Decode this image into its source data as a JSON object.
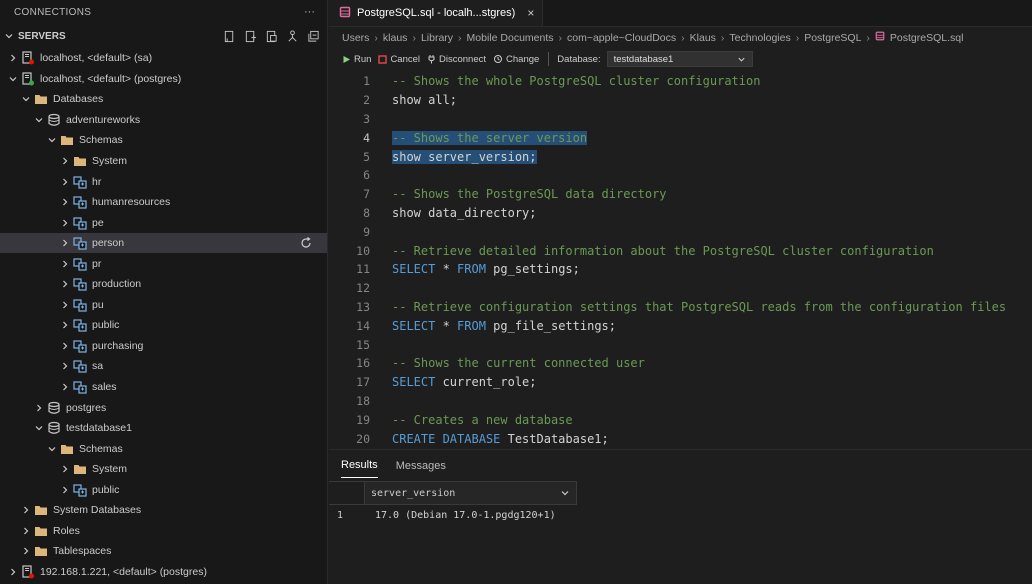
{
  "sidebar": {
    "title": "CONNECTIONS",
    "more": "···",
    "servers_label": "SERVERS",
    "tree": [
      {
        "label": "localhost, <default> (sa)",
        "depth": 1,
        "chev": "right",
        "icon": "server-error"
      },
      {
        "label": "localhost, <default> (postgres)",
        "depth": 1,
        "chev": "down",
        "icon": "server-connected"
      },
      {
        "label": "Databases",
        "depth": 2,
        "chev": "down",
        "icon": "folder"
      },
      {
        "label": "adventureworks",
        "depth": 3,
        "chev": "down",
        "icon": "database"
      },
      {
        "label": "Schemas",
        "depth": 4,
        "chev": "down",
        "icon": "folder"
      },
      {
        "label": "System",
        "depth": 5,
        "chev": "right",
        "icon": "folder"
      },
      {
        "label": "hr",
        "depth": 5,
        "chev": "right",
        "icon": "schema"
      },
      {
        "label": "humanresources",
        "depth": 5,
        "chev": "right",
        "icon": "schema"
      },
      {
        "label": "pe",
        "depth": 5,
        "chev": "right",
        "icon": "schema"
      },
      {
        "label": "person",
        "depth": 5,
        "chev": "right",
        "icon": "schema",
        "selected": true
      },
      {
        "label": "pr",
        "depth": 5,
        "chev": "right",
        "icon": "schema"
      },
      {
        "label": "production",
        "depth": 5,
        "chev": "right",
        "icon": "schema"
      },
      {
        "label": "pu",
        "depth": 5,
        "chev": "right",
        "icon": "schema"
      },
      {
        "label": "public",
        "depth": 5,
        "chev": "right",
        "icon": "schema"
      },
      {
        "label": "purchasing",
        "depth": 5,
        "chev": "right",
        "icon": "schema"
      },
      {
        "label": "sa",
        "depth": 5,
        "chev": "right",
        "icon": "schema"
      },
      {
        "label": "sales",
        "depth": 5,
        "chev": "right",
        "icon": "schema"
      },
      {
        "label": "postgres",
        "depth": 3,
        "chev": "right",
        "icon": "database"
      },
      {
        "label": "testdatabase1",
        "depth": 3,
        "chev": "down",
        "icon": "database"
      },
      {
        "label": "Schemas",
        "depth": 4,
        "chev": "down",
        "icon": "folder"
      },
      {
        "label": "System",
        "depth": 5,
        "chev": "right",
        "icon": "folder"
      },
      {
        "label": "public",
        "depth": 5,
        "chev": "right",
        "icon": "schema"
      },
      {
        "label": "System Databases",
        "depth": 2,
        "chev": "right",
        "icon": "folder"
      },
      {
        "label": "Roles",
        "depth": 2,
        "chev": "right",
        "icon": "folder"
      },
      {
        "label": "Tablespaces",
        "depth": 2,
        "chev": "right",
        "icon": "folder"
      },
      {
        "label": "192.168.1.221, <default> (postgres)",
        "depth": 1,
        "chev": "right",
        "icon": "server-error"
      }
    ]
  },
  "editor": {
    "tab_title": "PostgreSQL.sql - localh...stgres)",
    "tab_close": "×",
    "breadcrumb": [
      "Users",
      "klaus",
      "Library",
      "Mobile Documents",
      "com~apple~CloudDocs",
      "Klaus",
      "Technologies",
      "PostgreSQL",
      "PostgreSQL.sql"
    ],
    "toolbar": {
      "run": "Run",
      "cancel": "Cancel",
      "disconnect": "Disconnect",
      "change": "Change",
      "database_label": "Database:",
      "database_value": "testdatabase1"
    },
    "lines": [
      {
        "n": "1",
        "tokens": [
          {
            "t": "-- Shows the whole PostgreSQL cluster configuration",
            "c": "cmt"
          }
        ]
      },
      {
        "n": "2",
        "tokens": [
          {
            "t": "show all;",
            "c": "plain"
          }
        ]
      },
      {
        "n": "3",
        "tokens": []
      },
      {
        "n": "4",
        "active": true,
        "tokens": [
          {
            "t": "-- Shows the server version",
            "c": "cmt",
            "hl": true
          }
        ]
      },
      {
        "n": "5",
        "tokens": [
          {
            "t": "show server_version;",
            "c": "plain",
            "hl": true
          }
        ]
      },
      {
        "n": "6",
        "tokens": []
      },
      {
        "n": "7",
        "tokens": [
          {
            "t": "-- Shows the PostgreSQL data directory",
            "c": "cmt"
          }
        ]
      },
      {
        "n": "8",
        "tokens": [
          {
            "t": "show data_directory;",
            "c": "plain"
          }
        ]
      },
      {
        "n": "9",
        "tokens": []
      },
      {
        "n": "10",
        "tokens": [
          {
            "t": "-- Retrieve detailed information about the PostgreSQL cluster configuration",
            "c": "cmt"
          }
        ]
      },
      {
        "n": "11",
        "tokens": [
          {
            "t": "SELECT",
            "c": "kw"
          },
          {
            "t": " * ",
            "c": "plain"
          },
          {
            "t": "FROM",
            "c": "kw"
          },
          {
            "t": " pg_settings;",
            "c": "plain"
          }
        ]
      },
      {
        "n": "12",
        "tokens": []
      },
      {
        "n": "13",
        "tokens": [
          {
            "t": "-- Retrieve configuration settings that PostgreSQL reads from the configuration files",
            "c": "cmt"
          }
        ]
      },
      {
        "n": "14",
        "tokens": [
          {
            "t": "SELECT",
            "c": "kw"
          },
          {
            "t": " * ",
            "c": "plain"
          },
          {
            "t": "FROM",
            "c": "kw"
          },
          {
            "t": " pg_file_settings;",
            "c": "plain"
          }
        ]
      },
      {
        "n": "15",
        "tokens": []
      },
      {
        "n": "16",
        "tokens": [
          {
            "t": "-- Shows the current connected user",
            "c": "cmt"
          }
        ]
      },
      {
        "n": "17",
        "tokens": [
          {
            "t": "SELECT",
            "c": "kw"
          },
          {
            "t": " current_role;",
            "c": "plain"
          }
        ]
      },
      {
        "n": "18",
        "tokens": []
      },
      {
        "n": "19",
        "tokens": [
          {
            "t": "-- Creates a new database",
            "c": "cmt"
          }
        ]
      },
      {
        "n": "20",
        "tokens": [
          {
            "t": "CREATE DATABASE",
            "c": "kw"
          },
          {
            "t": " TestDatabase1;",
            "c": "plain"
          }
        ]
      }
    ]
  },
  "results": {
    "tabs": [
      "Results",
      "Messages"
    ],
    "column": "server_version",
    "rows": [
      {
        "n": "1",
        "value": "17.0 (Debian 17.0-1.pgdg120+1)"
      }
    ]
  },
  "colors": {
    "accent": "#264f78",
    "comment": "#6a9955",
    "keyword": "#569cd6",
    "error": "#e51400",
    "connected": "#37a94e"
  }
}
